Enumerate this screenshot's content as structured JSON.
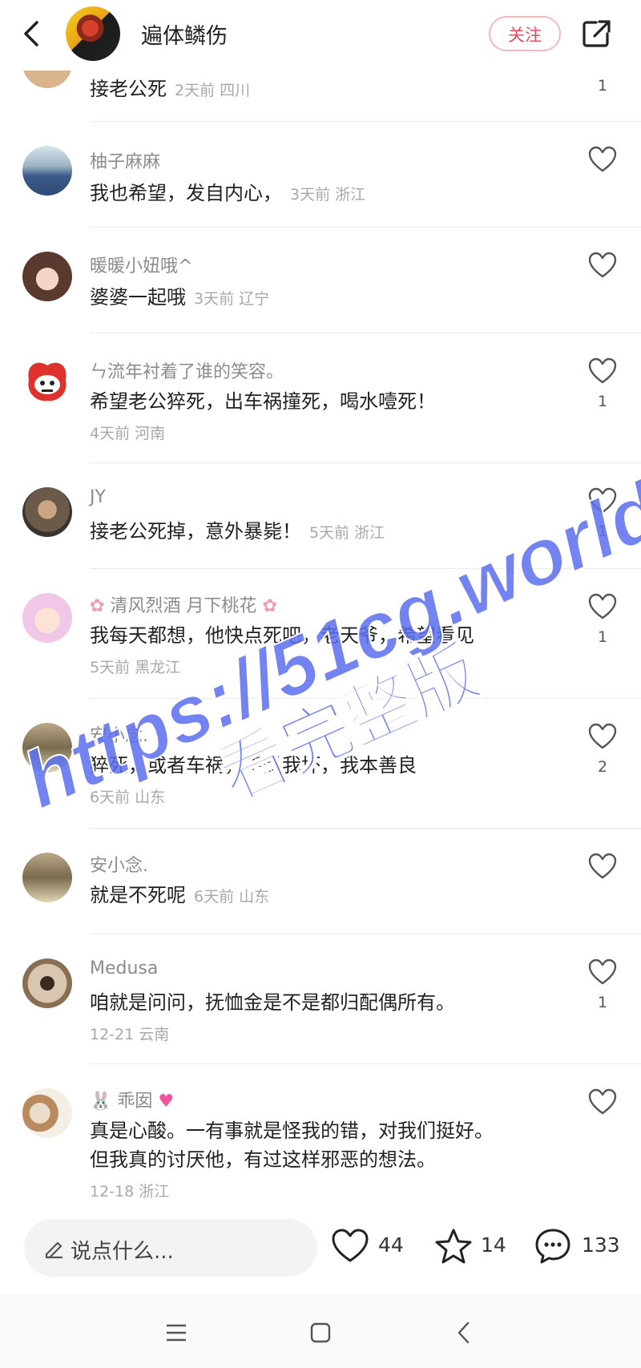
{
  "header": {
    "author_name": "遍体鳞伤",
    "follow_label": "关注"
  },
  "comments": [
    {
      "nick": "",
      "text": "接老公死",
      "meta": "2天前  四川",
      "likes": "1"
    },
    {
      "nick": "柚子麻麻",
      "text": "我也希望，发自内心，",
      "meta": "3天前  浙江",
      "likes": ""
    },
    {
      "nick": "暖暖小妞哦^",
      "text": "婆婆一起哦",
      "meta": "3天前  辽宁",
      "likes": ""
    },
    {
      "nick": "ㄣ流年衬着了谁的笑容。",
      "text": "希望老公猝死，出车祸撞死，喝水噎死！",
      "meta": "4天前  河南",
      "likes": "1"
    },
    {
      "nick": "JY",
      "text": "接老公死掉，意外暴毙！",
      "meta": "5天前  浙江",
      "likes": "1"
    },
    {
      "nick": "清风烈酒 月下桃花",
      "text": "我每天都想，他快点死吧，老天爷，希望看见",
      "meta": "5天前  黑龙江",
      "likes": "1"
    },
    {
      "nick": "安小念.",
      "text": "猝死，或者车祸，不是我坏，我本善良",
      "meta": "6天前  山东",
      "likes": "2"
    },
    {
      "nick": "安小念.",
      "text": "就是不死呢",
      "meta": "6天前  山东",
      "likes": ""
    },
    {
      "nick": "Medusa",
      "text": "咱就是问问，抚恤金是不是都归配偶所有。",
      "meta": "12-21  云南",
      "likes": "1"
    },
    {
      "nick": "乖囡",
      "text": "真是心酸。一有事就是怪我的错，对我们挺好。",
      "text2": "但我真的讨厌他，有过这样邪恶的想法。",
      "meta": "12-18  浙江",
      "likes": ""
    }
  ],
  "watermark": {
    "url": "https://51cg.world",
    "caption": "看完整版"
  },
  "bottom": {
    "placeholder": "说点什么...",
    "likes": "44",
    "stars": "14",
    "comments": "133"
  },
  "colors": {
    "accent": "#e84a5a",
    "watermark": "#5b6ef0"
  },
  "icons": [
    "back-arrow-icon",
    "share-icon",
    "heart-icon",
    "star-icon",
    "chat-bubble-icon",
    "pen-icon",
    "menu-icon",
    "home-square-icon",
    "nav-back-icon",
    "rabbit-icon",
    "pink-heart-icon",
    "cherry-blossom-icon"
  ]
}
